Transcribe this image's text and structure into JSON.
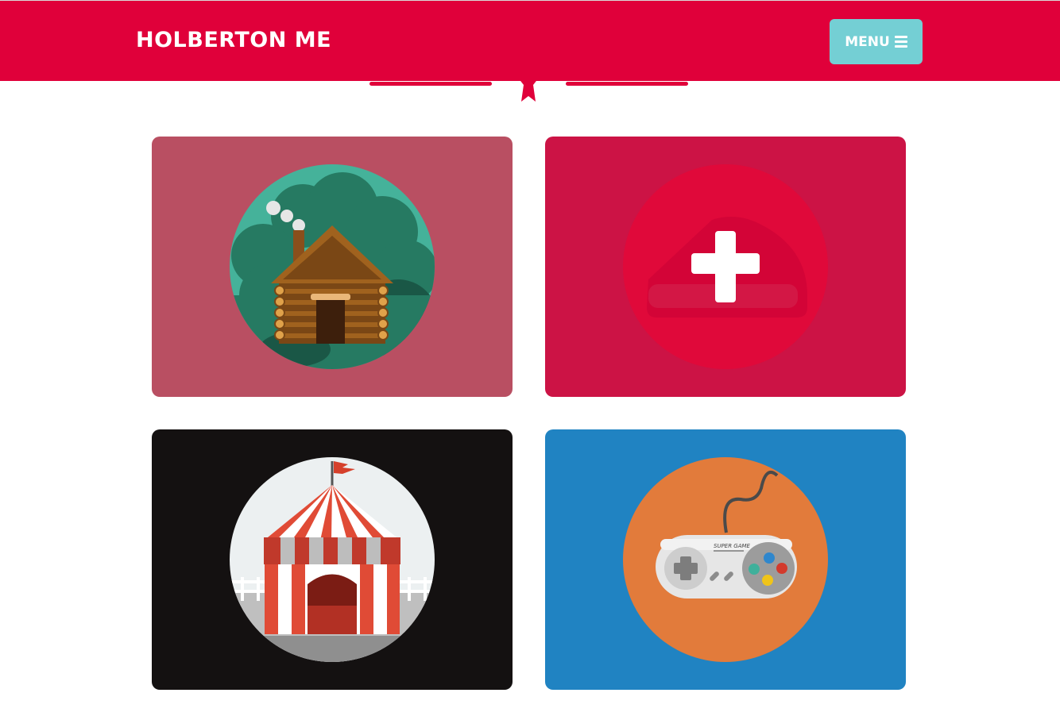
{
  "navbar": {
    "brand": "HOLBERTON ME",
    "menu_label": "MENU",
    "background": "#e0003a",
    "menu_color": "#74cfd4"
  },
  "divider": {
    "icon": "star-icon",
    "color": "#e0003a"
  },
  "portfolio": {
    "items": [
      {
        "icon": "log-cabin-icon",
        "background": "#b94f62",
        "circle": "#45b29a"
      },
      {
        "icon": "plus-icon",
        "background": "#cc1345",
        "circle": "#e0093a"
      },
      {
        "icon": "circus-tent-icon",
        "background": "#141111",
        "circle": "#ecf0f1"
      },
      {
        "icon": "game-controller-icon",
        "background": "#2083c2",
        "circle": "#e27b3b",
        "controller_text": "SUPER GAME"
      }
    ]
  }
}
